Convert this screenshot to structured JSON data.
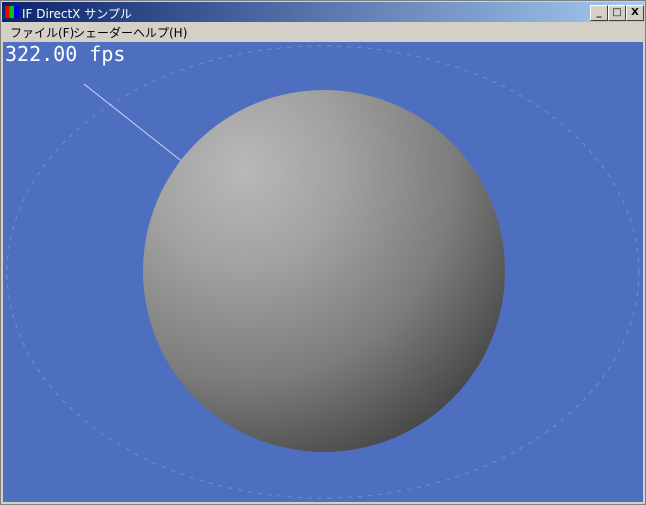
{
  "window": {
    "title": "IF DirectX サンプル",
    "buttons": {
      "minimize": "_",
      "maximize": "□",
      "close": "X"
    }
  },
  "menu": {
    "items": [
      {
        "label": "ファイル(F)"
      },
      {
        "label": "シェーダー"
      },
      {
        "label": "ヘルプ(H)"
      }
    ]
  },
  "viewport": {
    "fps_text": "322.00 fps",
    "background_color": "#4e6ec0"
  }
}
